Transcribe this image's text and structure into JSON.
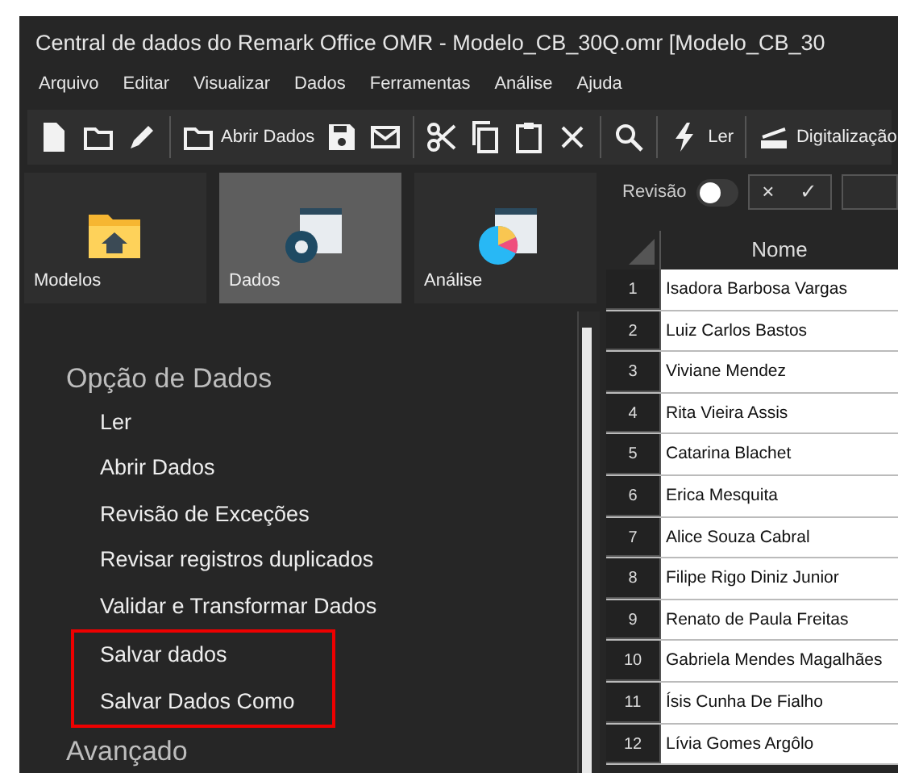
{
  "window": {
    "title": "Central de dados do Remark Office OMR - Modelo_CB_30Q.omr [Modelo_CB_30"
  },
  "menu": [
    "Arquivo",
    "Editar",
    "Visualizar",
    "Dados",
    "Ferramentas",
    "Análise",
    "Ajuda"
  ],
  "toolbar": [
    [
      {
        "kind": "icon"
      },
      {
        "kind": "icon"
      },
      {
        "kind": "icon"
      }
    ],
    [
      {
        "kind": "labeled",
        "label": "Abrir Dados"
      },
      {
        "kind": "icon"
      },
      {
        "kind": "icon"
      }
    ],
    [
      {
        "kind": "icon"
      },
      {
        "kind": "icon"
      },
      {
        "kind": "icon"
      },
      {
        "kind": "icon"
      }
    ],
    [
      {
        "kind": "icon"
      }
    ],
    [
      {
        "kind": "labeled",
        "label": "Ler"
      }
    ],
    [
      {
        "kind": "labeled",
        "label": "Digitalização"
      }
    ]
  ],
  "nav_tiles": [
    {
      "label": "Modelos",
      "selected": false
    },
    {
      "label": "Dados",
      "selected": true
    },
    {
      "label": "Análise",
      "selected": false
    }
  ],
  "sidebar": {
    "heading": "Opção de Dados",
    "items": [
      {
        "label": "Ler",
        "highlighted": false
      },
      {
        "label": "Abrir Dados",
        "highlighted": false
      },
      {
        "label": "Revisão de Exceções",
        "highlighted": false
      },
      {
        "label": "Revisar registros duplicados",
        "highlighted": false
      },
      {
        "label": "Validar e Transformar Dados",
        "highlighted": false
      },
      {
        "label": "Salvar dados",
        "highlighted": true
      },
      {
        "label": "Salvar Dados Como",
        "highlighted": true
      }
    ],
    "next_heading": "Avançado"
  },
  "review": {
    "label": "Revisão",
    "on": false,
    "reject": "×",
    "accept": "✓"
  },
  "table": {
    "columns": [
      "Nome"
    ],
    "rows": [
      {
        "num": "1",
        "name": "Isadora Barbosa Vargas"
      },
      {
        "num": "2",
        "name": "Luiz Carlos Bastos"
      },
      {
        "num": "3",
        "name": "Viviane Mendez"
      },
      {
        "num": "4",
        "name": "Rita Vieira Assis"
      },
      {
        "num": "5",
        "name": "Catarina Blachet"
      },
      {
        "num": "6",
        "name": "Erica Mesquita"
      },
      {
        "num": "7",
        "name": "Alice Souza Cabral"
      },
      {
        "num": "8",
        "name": "Filipe Rigo Diniz Junior"
      },
      {
        "num": "9",
        "name": "Renato de Paula Freitas"
      },
      {
        "num": "10",
        "name": "Gabriela Mendes Magalhães"
      },
      {
        "num": "11",
        "name": "Ísis Cunha De Fialho"
      },
      {
        "num": "12",
        "name": "Lívia Gomes Argôlo"
      }
    ]
  }
}
